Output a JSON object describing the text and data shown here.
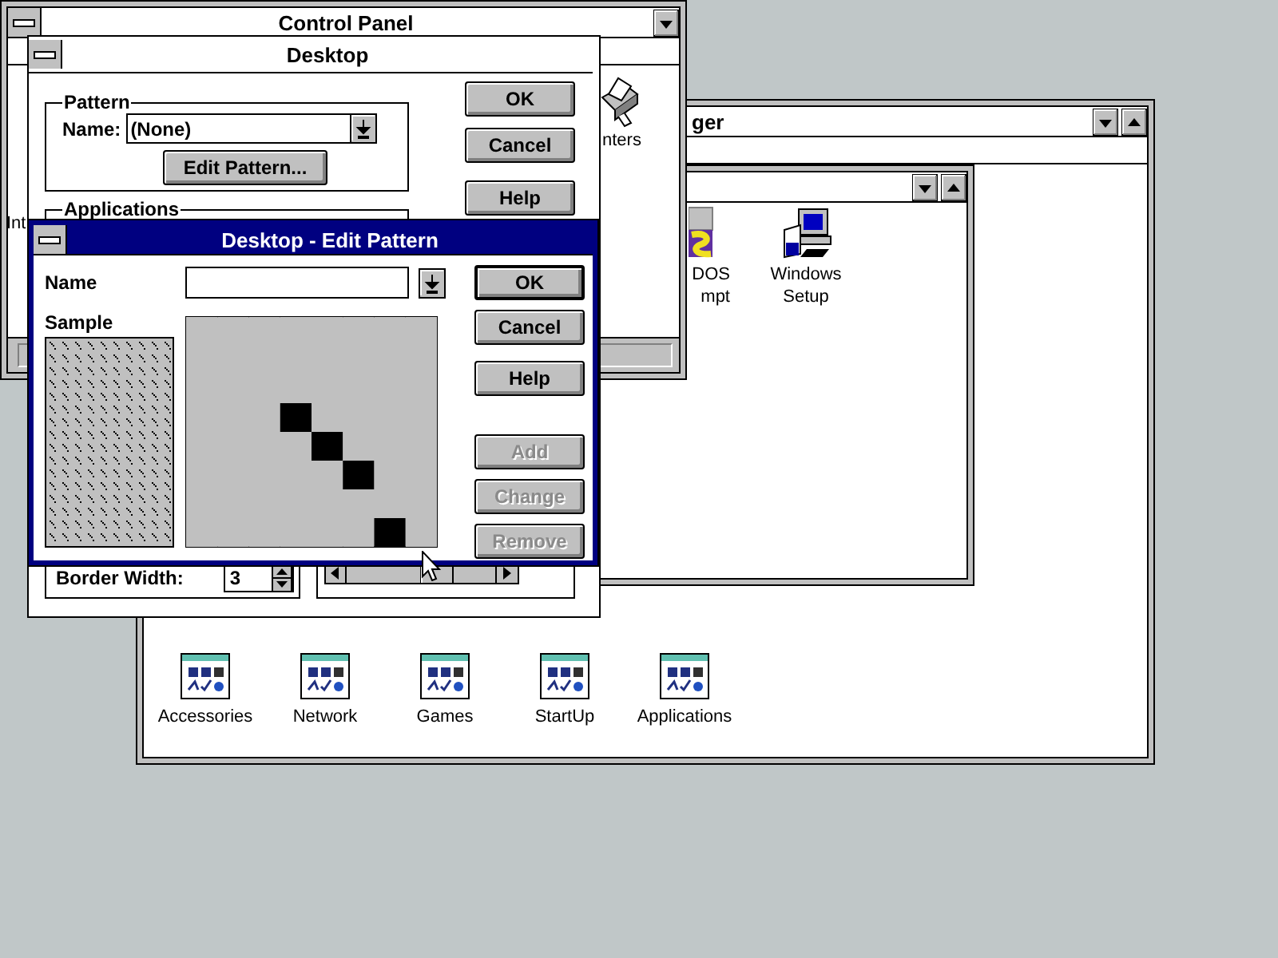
{
  "program_manager": {
    "title": "ger",
    "group_window": {
      "icons": [
        {
          "label": "DOS\nmpt",
          "kind": "msdos"
        },
        {
          "label": "Windows\nSetup",
          "kind": "setup"
        }
      ]
    },
    "groups": [
      {
        "label": "Accessories"
      },
      {
        "label": "Network"
      },
      {
        "label": "Games"
      },
      {
        "label": "StartUp"
      },
      {
        "label": "Applications"
      }
    ]
  },
  "control_panel": {
    "title": "Control Panel",
    "icons": [
      {
        "label": "nters",
        "kind": "printer"
      },
      {
        "label": "Int",
        "kind": "text"
      }
    ]
  },
  "desktop_dialog": {
    "title": "Desktop",
    "pattern": {
      "legend": "Pattern",
      "name_label": "Name:",
      "name_value": "(None)",
      "edit_button": "Edit Pattern..."
    },
    "applications_legend": "Applications",
    "border_width_label": "Border Width:",
    "border_width_value": "3",
    "buttons": [
      {
        "label": "OK"
      },
      {
        "label": "Cancel"
      },
      {
        "label": "Help"
      }
    ]
  },
  "edit_pattern": {
    "title": "Desktop - Edit Pattern",
    "name_label": "Name",
    "sample_label": "Sample",
    "pattern": [
      [
        false,
        false,
        false,
        false,
        false,
        false,
        false,
        false
      ],
      [
        false,
        false,
        false,
        false,
        false,
        false,
        false,
        false
      ],
      [
        false,
        false,
        false,
        false,
        false,
        false,
        false,
        false
      ],
      [
        false,
        false,
        false,
        true,
        false,
        false,
        false,
        false
      ],
      [
        false,
        false,
        false,
        false,
        true,
        false,
        false,
        false
      ],
      [
        false,
        false,
        false,
        false,
        false,
        true,
        false,
        false
      ],
      [
        false,
        false,
        false,
        false,
        false,
        false,
        false,
        false
      ],
      [
        false,
        false,
        false,
        false,
        false,
        false,
        true,
        false
      ]
    ],
    "buttons": [
      {
        "label": "OK",
        "default": true,
        "disabled": false
      },
      {
        "label": "Cancel",
        "default": false,
        "disabled": false
      },
      {
        "label": "Help",
        "default": false,
        "disabled": false
      },
      {
        "label": "Add",
        "default": false,
        "disabled": true
      },
      {
        "label": "Change",
        "default": false,
        "disabled": true
      },
      {
        "label": "Remove",
        "default": false,
        "disabled": true
      }
    ]
  }
}
